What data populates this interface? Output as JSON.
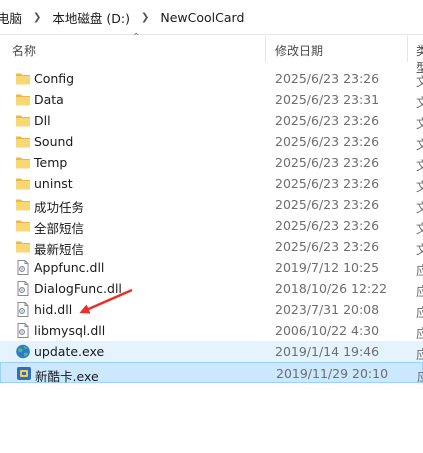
{
  "breadcrumb": [
    "电脑",
    "本地磁盘 (D:)",
    "NewCoolCard"
  ],
  "columns": {
    "name": "名称",
    "date": "修改日期",
    "type": "类型"
  },
  "colors": {
    "folder": "#f8d775",
    "selection": "#cce8ff",
    "hover": "#e5f3ff",
    "annotation_arrow": "#e8312a"
  },
  "files": [
    {
      "name": "Config",
      "date": "2025/6/23 23:26",
      "type": "文",
      "icon": "folder-icon"
    },
    {
      "name": "Data",
      "date": "2025/6/23 23:31",
      "type": "文",
      "icon": "folder-icon"
    },
    {
      "name": "Dll",
      "date": "2025/6/23 23:26",
      "type": "文",
      "icon": "folder-icon"
    },
    {
      "name": "Sound",
      "date": "2025/6/23 23:26",
      "type": "文",
      "icon": "folder-icon"
    },
    {
      "name": "Temp",
      "date": "2025/6/23 23:26",
      "type": "文",
      "icon": "folder-icon"
    },
    {
      "name": "uninst",
      "date": "2025/6/23 23:26",
      "type": "文",
      "icon": "folder-icon"
    },
    {
      "name": "成功任务",
      "date": "2025/6/23 23:26",
      "type": "文",
      "icon": "folder-icon"
    },
    {
      "name": "全部短信",
      "date": "2025/6/23 23:26",
      "type": "文",
      "icon": "folder-icon"
    },
    {
      "name": "最新短信",
      "date": "2025/6/23 23:26",
      "type": "文",
      "icon": "folder-icon"
    },
    {
      "name": "Appfunc.dll",
      "date": "2019/7/12 10:25",
      "type": "应",
      "icon": "dll-file-icon"
    },
    {
      "name": "DialogFunc.dll",
      "date": "2018/10/26 12:22",
      "type": "应",
      "icon": "dll-file-icon"
    },
    {
      "name": "hid.dll",
      "date": "2023/7/31 20:08",
      "type": "应",
      "icon": "dll-file-icon"
    },
    {
      "name": "libmysql.dll",
      "date": "2006/10/22 4:30",
      "type": "应",
      "icon": "dll-file-icon"
    },
    {
      "name": "update.exe",
      "date": "2019/1/14 19:46",
      "type": "应",
      "icon": "globe-exe-icon"
    },
    {
      "name": "新酷卡.exe",
      "date": "2019/11/29 20:10",
      "type": "应",
      "icon": "app-exe-icon"
    }
  ]
}
